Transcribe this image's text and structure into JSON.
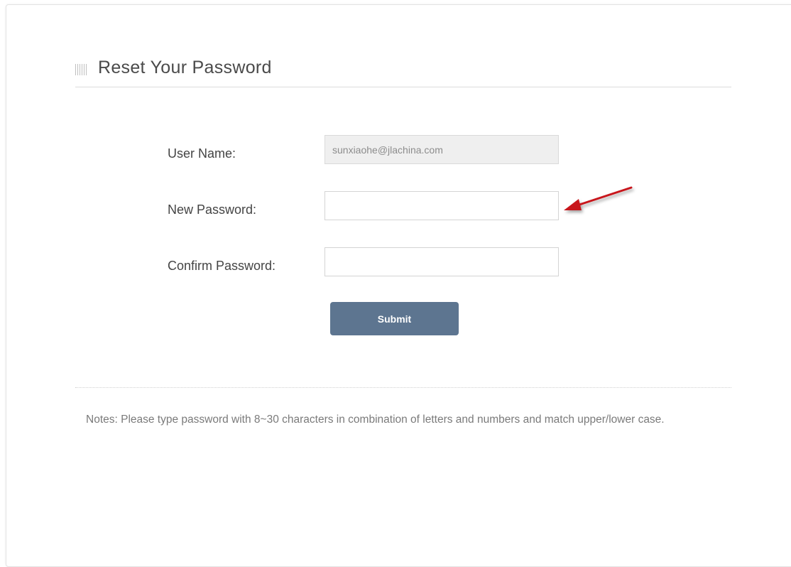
{
  "page": {
    "title": "Reset Your Password"
  },
  "form": {
    "username": {
      "label": "User Name:",
      "value": "sunxiaohe@jlachina.com"
    },
    "new_password": {
      "label": "New Password:",
      "value": ""
    },
    "confirm_password": {
      "label": "Confirm Password:",
      "value": ""
    },
    "submit_label": "Submit"
  },
  "notes": "Notes: Please type password with 8~30 characters in combination of letters and numbers and match upper/lower case.",
  "icons": {
    "title_icon": "grid-icon",
    "annotation": "red-arrow-icon"
  },
  "colors": {
    "button": "#5d7590",
    "arrow": "#c8191e",
    "readonly_field": "#efefef"
  }
}
